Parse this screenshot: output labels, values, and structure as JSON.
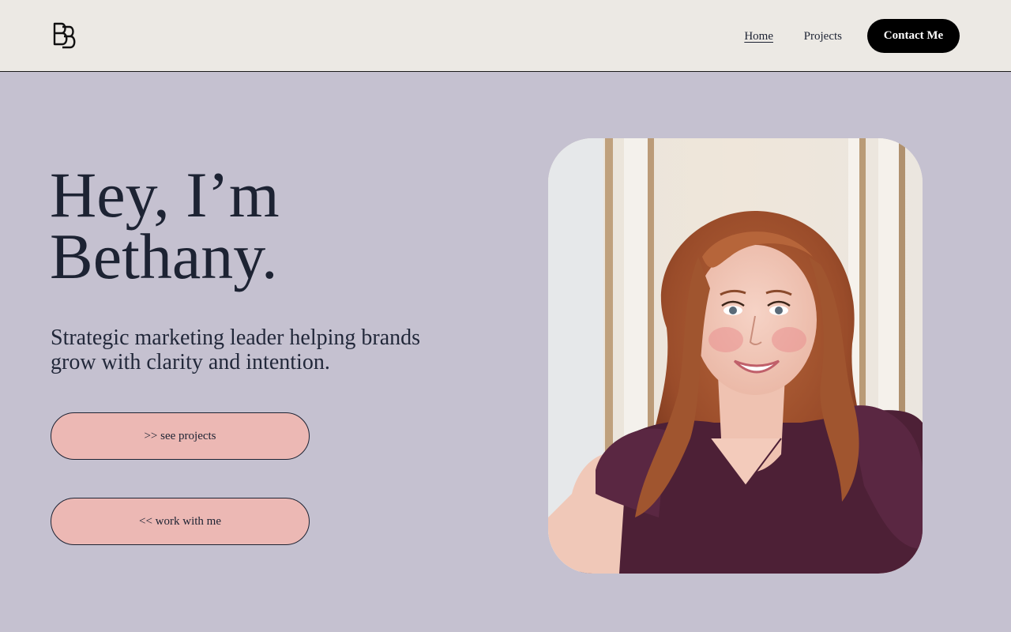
{
  "header": {
    "logo_icon": "bb-monogram-logo",
    "nav": {
      "home_label": "Home",
      "projects_label": "Projects",
      "contact_label": "Contact Me"
    }
  },
  "hero": {
    "headline_line1": "Hey, I’m",
    "headline_line2": "Bethany.",
    "tagline": "Strategic marketing leader helping brands grow with clarity and intention.",
    "cta_projects": ">> see projects",
    "cta_work": "<< work with me"
  },
  "portrait": {
    "alt": "Bethany portrait"
  },
  "colors": {
    "header_bg": "#ece9e4",
    "page_bg": "#c5c1d0",
    "button_pink": "#ecb8b4",
    "contact_bg": "#000000",
    "text_dark": "#1d2333"
  }
}
